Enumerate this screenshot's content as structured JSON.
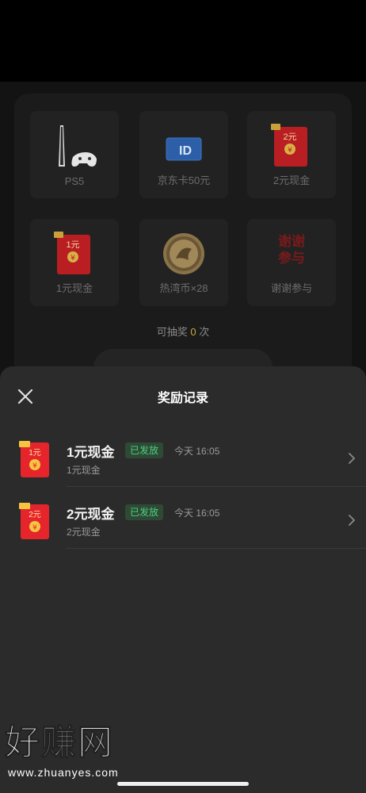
{
  "lottery": {
    "prizes": [
      {
        "label": "PS5",
        "icon": "ps5-console-icon"
      },
      {
        "label": "京东卡50元",
        "icon": "jd-card-icon"
      },
      {
        "label": "2元现金",
        "icon": "red-envelope-icon",
        "amount": "2元"
      },
      {
        "label": "1元现金",
        "icon": "red-envelope-icon",
        "amount": "1元"
      },
      {
        "label": "热湾币×28",
        "icon": "coin-icon"
      },
      {
        "label": "谢谢参与",
        "icon": "thanks-icon",
        "text": "谢谢参与"
      }
    ],
    "draw_count_prefix": "可抽奖",
    "draw_count_value": "0",
    "draw_count_suffix": "次",
    "jd_card_text": "ID"
  },
  "sheet": {
    "title": "奖励记录",
    "records": [
      {
        "title": "1元现金",
        "status": "已发放",
        "time": "今天 16:05",
        "subtitle": "1元现金",
        "amount": "1元"
      },
      {
        "title": "2元现金",
        "status": "已发放",
        "time": "今天 16:05",
        "subtitle": "2元现金",
        "amount": "2元"
      }
    ]
  },
  "watermark": {
    "text_main": "好赚网",
    "text_url": "www.zhuanyes.com"
  },
  "colors": {
    "accent_green": "#4cd07d",
    "red_envelope": "#e6242b",
    "gold": "#f5c542"
  }
}
